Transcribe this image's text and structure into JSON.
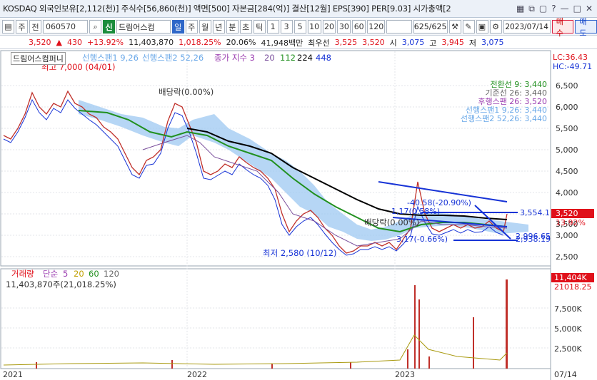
{
  "titlebar": {
    "text": "KOSDAQ 외국인보유[2,112(천)] 주식수[56,860(천)] 액면[500] 자본금[284(억)] 결산[12월] EPS[390] PER[9.03] 시가총액[2",
    "icons": [
      "grid-icon",
      "window-icon",
      "restore-icon",
      "help-icon",
      "minimize-icon",
      "maximize-icon",
      "close-icon"
    ]
  },
  "toolbar": {
    "period_type": "주",
    "prev_btn": "전",
    "code": "060570",
    "badge": "신",
    "stock_name": "드림어스컴",
    "tabs": [
      "일",
      "주",
      "월",
      "년",
      "분",
      "초",
      "틱"
    ],
    "intervals": [
      "1",
      "3",
      "5",
      "10",
      "20",
      "30",
      "60",
      "120"
    ],
    "page": "625/625",
    "date": "2023/07/14",
    "buy": "매수",
    "sell": "매도"
  },
  "quote": {
    "price": "3,520",
    "change": "430",
    "change_pct": "+13.92%",
    "volume": "11,403,870",
    "amount": "1,018.25%",
    "ratio": "20.06%",
    "value": "41,948백만",
    "ask_label": "최우선",
    "ask1": "3,525",
    "bid1": "3,520",
    "open_label": "시",
    "open": "3,075",
    "high_label": "고",
    "high": "3,945",
    "low_label": "저",
    "low": "3,075"
  },
  "chart": {
    "stock_label": "드림어스컴퍼니",
    "ichimoku_legend": [
      "선행스팬1 9,26",
      "선행스팬2 52,26"
    ],
    "ma_legend": {
      "name": "종가 지수 3",
      "periods": [
        "20",
        "112",
        "224",
        "448"
      ]
    },
    "high_note": "최고 7,000 (04/01)",
    "low_note": "최저 2,580 (10/12)",
    "div_note1": "배당락(0.00%)",
    "div_note2": "배당락(0.00%)",
    "trend_note1": "-40.58(-20.90%)",
    "trend_note2": "1,17(0.58%)",
    "trend_note3": "3,17(-0.66%)",
    "line_val1": "3,554.1",
    "line_val2": "2,996.65",
    "line_val3": "2,938.19",
    "legend_right": [
      "전환선 9: 3,440",
      "기준선 26: 3,440",
      "후행스팬 26: 3,520",
      "선행스팬1 9,26: 3,440",
      "선행스팬2 52,26: 3,440"
    ],
    "hc": "HC:-49.71",
    "lc": "LC:36.43",
    "y_ticks": [
      "6,500",
      "6,000",
      "5,500",
      "5,000",
      "4,500",
      "4,000",
      "3,500",
      "3,000",
      "2,500"
    ],
    "price_tag": "3,520",
    "price_pct": "13.92%",
    "vol_legend": {
      "name": "거래량",
      "type": "단순",
      "periods": [
        "5",
        "20",
        "60",
        "120"
      ]
    },
    "vol_value": "11,403,870주(21,018.25%)",
    "vol_ticks": [
      "7,500K",
      "5,000K",
      "2,500K"
    ],
    "vol_tag": "11,404K",
    "vol_pct": "21018.25",
    "x_labels": [
      "2021",
      "2022",
      "2023",
      "07/14"
    ]
  },
  "colors": {
    "up": "#e0101a",
    "down": "#1733d6",
    "ma20": "#7a4f9c",
    "ma112": "#21901f",
    "ma224": "#000000",
    "cloud": "#9ec8f2"
  }
}
